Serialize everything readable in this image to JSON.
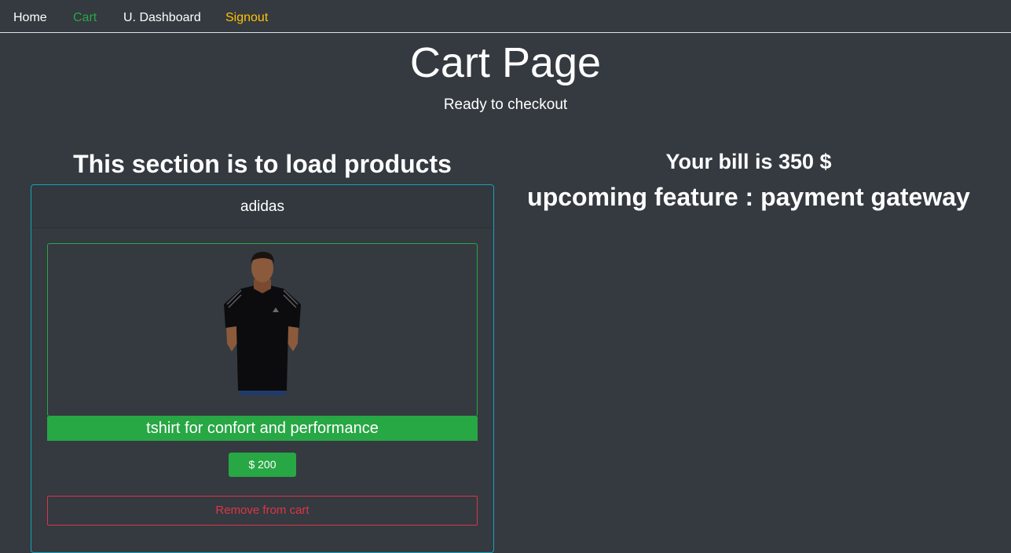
{
  "nav": {
    "home": "Home",
    "cart": "Cart",
    "dashboard": "U. Dashboard",
    "signout": "Signout"
  },
  "hero": {
    "title": "Cart Page",
    "subtitle": "Ready to checkout"
  },
  "products_section": {
    "heading": "This section is to load products",
    "items": [
      {
        "name": "adidas",
        "description": "tshirt for confort and performance",
        "price_label": "$ 200",
        "remove_label": "Remove from cart"
      }
    ]
  },
  "summary": {
    "bill": "Your bill is 350 $",
    "upcoming": "upcoming feature : payment gateway"
  },
  "colors": {
    "background": "#343a40",
    "active_nav": "#28a745",
    "signout": "#ffc107",
    "card_border": "#17a2b8",
    "success": "#28a745",
    "danger": "#dc3545"
  }
}
